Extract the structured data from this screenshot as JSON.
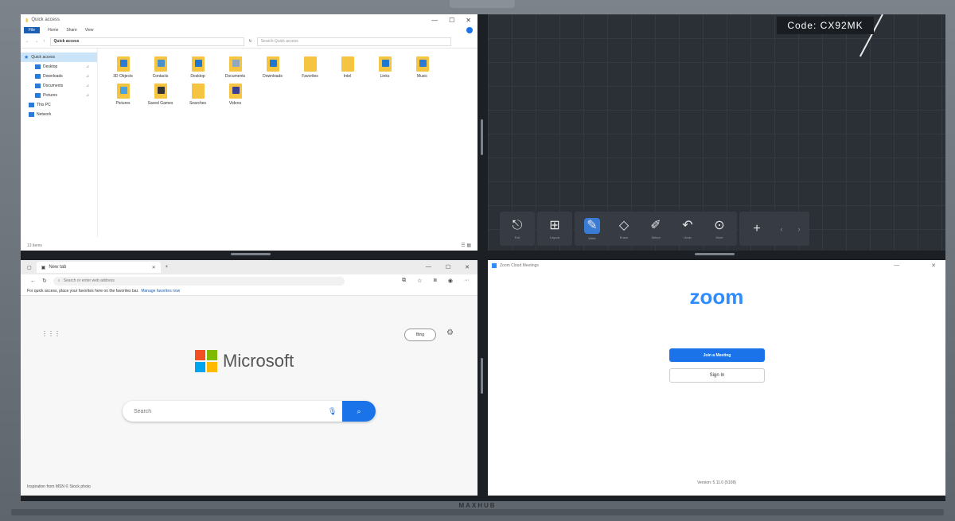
{
  "explorer": {
    "title": "Quick access",
    "window_controls": [
      "—",
      "☐",
      "✕"
    ],
    "ribbon": [
      "File",
      "Home",
      "Share",
      "View"
    ],
    "path": "Quick access",
    "search_placeholder": "Search Quick access",
    "nav": [
      {
        "label": "Quick access",
        "icon": "star-icon",
        "pinned": false
      },
      {
        "label": "Desktop",
        "icon": "desktop-icon",
        "pinned": true
      },
      {
        "label": "Downloads",
        "icon": "download-icon",
        "pinned": true
      },
      {
        "label": "Documents",
        "icon": "document-icon",
        "pinned": true
      },
      {
        "label": "Pictures",
        "icon": "picture-icon",
        "pinned": true
      },
      {
        "label": "This PC",
        "icon": "computer-icon",
        "pinned": false
      },
      {
        "label": "Network",
        "icon": "network-icon",
        "pinned": false
      }
    ],
    "files": [
      {
        "label": "3D Objects",
        "overlay": "#2b7bd6"
      },
      {
        "label": "Contacts",
        "overlay": "#4a90c8"
      },
      {
        "label": "Desktop",
        "overlay": "#1f77d0"
      },
      {
        "label": "Documents",
        "overlay": "#8fa8c0"
      },
      {
        "label": "Downloads",
        "overlay": "#1f77d0"
      },
      {
        "label": "Favorites",
        "overlay": "#f5c542"
      },
      {
        "label": "Intel",
        "overlay": "#f5c542"
      },
      {
        "label": "Links",
        "overlay": "#1f77d0"
      },
      {
        "label": "Music",
        "overlay": "#2b7bd6"
      },
      {
        "label": "Pictures",
        "overlay": "#4aa3df"
      },
      {
        "label": "Saved Games",
        "overlay": "#333333"
      },
      {
        "label": "Searches",
        "overlay": "#f5c542"
      },
      {
        "label": "Videos",
        "overlay": "#3b3f8f"
      }
    ],
    "status": "13 items"
  },
  "whiteboard": {
    "code": "Code: CX92MK",
    "toolbar": [
      {
        "label": "Exit",
        "icon": "exit-icon",
        "glyph": "⎋"
      },
      {
        "label": "Layout",
        "icon": "layout-icon",
        "glyph": "⊞"
      },
      {
        "label": "Write",
        "icon": "pen-icon",
        "glyph": "✎",
        "active": true
      },
      {
        "label": "Erase",
        "icon": "eraser-icon",
        "glyph": "◇"
      },
      {
        "label": "Select",
        "icon": "select-icon",
        "glyph": "✐"
      },
      {
        "label": "Undo",
        "icon": "undo-icon",
        "glyph": "↶"
      },
      {
        "label": "More",
        "icon": "more-icon",
        "glyph": "⊙"
      }
    ],
    "add_glyph": "+",
    "prev_glyph": "‹",
    "next_glyph": "›"
  },
  "edge": {
    "tab_title": "New tab",
    "address_placeholder": "Search or enter web address",
    "fav_text": "For quick access, place your favorites here on the favorites bar.",
    "fav_link": "Manage favorites now",
    "bing_label": "Bing",
    "search_value": "Search",
    "brand": "Microsoft",
    "footer": "Inspiration from MSN © Stock photo",
    "window_controls": [
      "—",
      "☐",
      "✕"
    ]
  },
  "zoom": {
    "window_title": "Zoom Cloud Meetings",
    "logo": "zoom",
    "join_label": "Join a Meeting",
    "sign_label": "Sign In",
    "version": "Version: 5.11.0 (5108)",
    "window_controls": [
      "—",
      "✕"
    ]
  },
  "device": {
    "brand": "MAXHUB"
  },
  "colors": {
    "zoom_blue": "#2d8cff",
    "accent_blue": "#1a73e8",
    "whiteboard_bg": "#2b2f36"
  }
}
